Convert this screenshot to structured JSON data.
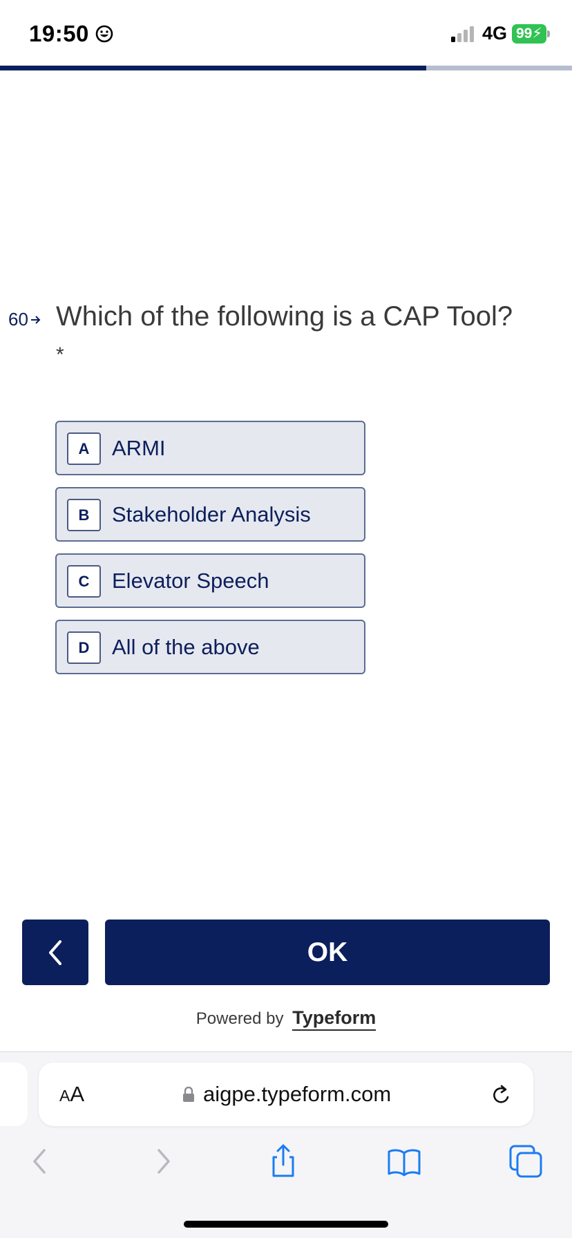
{
  "status_bar": {
    "time": "19:50",
    "network": "4G",
    "battery": "99"
  },
  "progress": {
    "percent": 74.5,
    "fill_color": "#0b1f5c",
    "track_color": "#b7bdd0"
  },
  "question": {
    "number": "60",
    "title": "Which of the following is a CAP Tool?",
    "required_mark": "*"
  },
  "options": [
    {
      "key": "A",
      "label": "ARMI"
    },
    {
      "key": "B",
      "label": "Stakeholder Analysis"
    },
    {
      "key": "C",
      "label": "Elevator Speech"
    },
    {
      "key": "D",
      "label": "All of the above"
    }
  ],
  "navigation": {
    "back_icon": "chevron-left-icon",
    "ok_label": "OK"
  },
  "footer": {
    "powered_by": "Powered by",
    "brand": "Typeform"
  },
  "browser": {
    "text_size_label": "AA",
    "url": "aigpe.typeform.com",
    "icons": [
      "back-icon",
      "forward-icon",
      "share-icon",
      "bookmarks-icon",
      "tabs-icon",
      "reload-icon",
      "lock-icon"
    ]
  },
  "colors": {
    "brand_navy": "#0b1f5c",
    "option_bg": "#e6e8ef",
    "battery_green": "#30c253"
  }
}
